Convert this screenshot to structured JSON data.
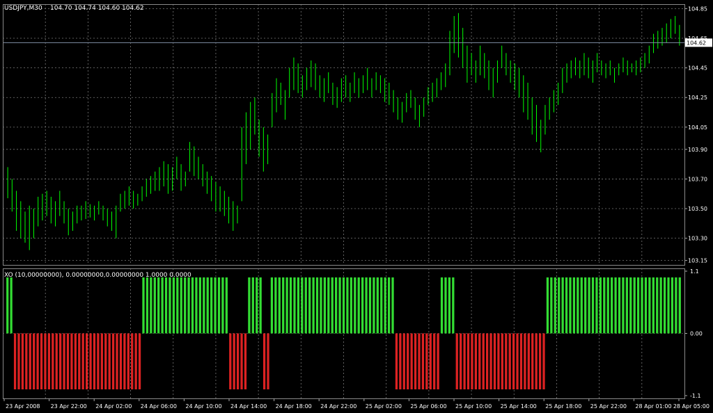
{
  "chart_data": [
    {
      "type": "bar",
      "title": "USDJPY,M30",
      "ohlc_text": "104.70 104.74 104.60 104.62",
      "bar_style": "HL-bars",
      "series_color": "#00ff00",
      "ylim": [
        103.12,
        104.88
      ],
      "y_ticks": [
        "104.85",
        "104.65",
        "104.45",
        "104.25",
        "104.05",
        "103.90",
        "103.70",
        "103.50",
        "103.30",
        "103.15"
      ],
      "current_price": "104.62",
      "current_price_line_color": "#7f8fa6",
      "grid": true,
      "grid_color": "#7a7a7a",
      "bars": [
        [
          103.78,
          103.57
        ],
        [
          103.7,
          103.48
        ],
        [
          103.62,
          103.35
        ],
        [
          103.55,
          103.3
        ],
        [
          103.48,
          103.27
        ],
        [
          103.52,
          103.22
        ],
        [
          103.5,
          103.3
        ],
        [
          103.58,
          103.38
        ],
        [
          103.6,
          103.42
        ],
        [
          103.62,
          103.45
        ],
        [
          103.58,
          103.4
        ],
        [
          103.55,
          103.38
        ],
        [
          103.62,
          103.45
        ],
        [
          103.55,
          103.4
        ],
        [
          103.5,
          103.32
        ],
        [
          103.48,
          103.35
        ],
        [
          103.52,
          103.4
        ],
        [
          103.52,
          103.42
        ],
        [
          103.55,
          103.43
        ],
        [
          103.53,
          103.44
        ],
        [
          103.52,
          103.42
        ],
        [
          103.55,
          103.46
        ],
        [
          103.52,
          103.42
        ],
        [
          103.5,
          103.38
        ],
        [
          103.48,
          103.35
        ],
        [
          103.52,
          103.3
        ],
        [
          103.6,
          103.48
        ],
        [
          103.62,
          103.5
        ],
        [
          103.65,
          103.52
        ],
        [
          103.62,
          103.5
        ],
        [
          103.6,
          103.52
        ],
        [
          103.65,
          103.55
        ],
        [
          103.7,
          103.58
        ],
        [
          103.72,
          103.6
        ],
        [
          103.75,
          103.62
        ],
        [
          103.78,
          103.62
        ],
        [
          103.82,
          103.65
        ],
        [
          103.8,
          103.6
        ],
        [
          103.78,
          103.62
        ],
        [
          103.85,
          103.7
        ],
        [
          103.8,
          103.62
        ],
        [
          103.75,
          103.65
        ],
        [
          103.95,
          103.75
        ],
        [
          103.92,
          103.72
        ],
        [
          103.85,
          103.7
        ],
        [
          103.8,
          103.65
        ],
        [
          103.75,
          103.6
        ],
        [
          103.72,
          103.55
        ],
        [
          103.68,
          103.48
        ],
        [
          103.65,
          103.48
        ],
        [
          103.62,
          103.45
        ],
        [
          103.58,
          103.4
        ],
        [
          103.55,
          103.35
        ],
        [
          103.52,
          103.4
        ],
        [
          104.05,
          103.55
        ],
        [
          104.15,
          103.8
        ],
        [
          104.22,
          103.9
        ],
        [
          104.25,
          104.0
        ],
        [
          104.1,
          103.85
        ],
        [
          104.05,
          103.75
        ],
        [
          104.0,
          103.8
        ],
        [
          104.28,
          104.05
        ],
        [
          104.38,
          104.15
        ],
        [
          104.35,
          104.2
        ],
        [
          104.3,
          104.1
        ],
        [
          104.45,
          104.25
        ],
        [
          104.52,
          104.3
        ],
        [
          104.48,
          104.28
        ],
        [
          104.4,
          104.25
        ],
        [
          104.45,
          104.3
        ],
        [
          104.5,
          104.32
        ],
        [
          104.48,
          104.3
        ],
        [
          104.4,
          104.25
        ],
        [
          104.38,
          104.22
        ],
        [
          104.42,
          104.28
        ],
        [
          104.35,
          104.2
        ],
        [
          104.32,
          104.18
        ],
        [
          104.38,
          104.22
        ],
        [
          104.4,
          104.25
        ],
        [
          104.35,
          104.22
        ],
        [
          104.42,
          104.28
        ],
        [
          104.38,
          104.25
        ],
        [
          104.4,
          104.28
        ],
        [
          104.45,
          104.3
        ],
        [
          104.38,
          104.25
        ],
        [
          104.42,
          104.3
        ],
        [
          104.4,
          104.28
        ],
        [
          104.38,
          104.22
        ],
        [
          104.35,
          104.2
        ],
        [
          104.3,
          104.15
        ],
        [
          104.25,
          104.1
        ],
        [
          104.22,
          104.08
        ],
        [
          104.28,
          104.15
        ],
        [
          104.3,
          104.18
        ],
        [
          104.25,
          104.1
        ],
        [
          104.2,
          104.05
        ],
        [
          104.25,
          104.12
        ],
        [
          104.32,
          104.2
        ],
        [
          104.35,
          104.22
        ],
        [
          104.38,
          104.25
        ],
        [
          104.42,
          104.3
        ],
        [
          104.48,
          104.32
        ],
        [
          104.7,
          104.4
        ],
        [
          104.8,
          104.55
        ],
        [
          104.82,
          104.52
        ],
        [
          104.72,
          104.45
        ],
        [
          104.6,
          104.35
        ],
        [
          104.55,
          104.4
        ],
        [
          104.5,
          104.35
        ],
        [
          104.6,
          104.4
        ],
        [
          104.55,
          104.38
        ],
        [
          104.5,
          104.3
        ],
        [
          104.45,
          104.25
        ],
        [
          104.5,
          104.35
        ],
        [
          104.6,
          104.45
        ],
        [
          104.55,
          104.4
        ],
        [
          104.5,
          104.35
        ],
        [
          104.48,
          104.3
        ],
        [
          104.45,
          104.25
        ],
        [
          104.4,
          104.15
        ],
        [
          104.35,
          104.1
        ],
        [
          104.25,
          104.0
        ],
        [
          104.2,
          103.95
        ],
        [
          104.1,
          103.88
        ],
        [
          104.2,
          104.0
        ],
        [
          104.25,
          104.1
        ],
        [
          104.3,
          104.15
        ],
        [
          104.35,
          104.2
        ],
        [
          104.45,
          104.28
        ],
        [
          104.48,
          104.35
        ],
        [
          104.5,
          104.38
        ],
        [
          104.52,
          104.4
        ],
        [
          104.5,
          104.38
        ],
        [
          104.55,
          104.4
        ],
        [
          104.52,
          104.38
        ],
        [
          104.5,
          104.35
        ],
        [
          104.55,
          104.42
        ],
        [
          104.5,
          104.4
        ],
        [
          104.48,
          104.38
        ],
        [
          104.5,
          104.4
        ],
        [
          104.45,
          104.35
        ],
        [
          104.48,
          104.4
        ],
        [
          104.52,
          104.42
        ],
        [
          104.5,
          104.4
        ],
        [
          104.48,
          104.42
        ],
        [
          104.5,
          104.4
        ],
        [
          104.52,
          104.42
        ],
        [
          104.55,
          104.45
        ],
        [
          104.6,
          104.48
        ],
        [
          104.68,
          104.55
        ],
        [
          104.7,
          104.58
        ],
        [
          104.72,
          104.6
        ],
        [
          104.75,
          104.62
        ],
        [
          104.78,
          104.65
        ],
        [
          104.8,
          104.68
        ],
        [
          104.74,
          104.6
        ]
      ]
    },
    {
      "type": "bar",
      "title": "XO (10,00000000), 0.00000000,0.00000000 1.0000 0.0000",
      "ylim": [
        -1.1,
        1.1
      ],
      "y_ticks": [
        "1.1",
        "0.00",
        "-1.1"
      ],
      "positive_color": "#33dd33",
      "negative_color": "#dd2222",
      "values": [
        1,
        1,
        -1,
        -1,
        -1,
        -1,
        -1,
        -1,
        -1,
        -1,
        -1,
        -1,
        -1,
        -1,
        -1,
        -1,
        -1,
        -1,
        -1,
        -1,
        -1,
        -1,
        -1,
        -1,
        -1,
        -1,
        -1,
        -1,
        -1,
        -1,
        -1,
        -1,
        -1,
        -1,
        -1,
        -1,
        1,
        1,
        1,
        1,
        1,
        1,
        1,
        1,
        1,
        1,
        1,
        1,
        1,
        1,
        1,
        1,
        1,
        1,
        1,
        1,
        1,
        1,
        1,
        -1,
        -1,
        -1,
        -1,
        -1,
        1,
        1,
        1,
        1,
        -1,
        -1,
        1,
        1,
        1,
        1,
        1,
        1,
        1,
        1,
        1,
        1,
        1,
        1,
        1,
        1,
        1,
        1,
        1,
        1,
        1,
        1,
        1,
        1,
        1,
        1,
        1,
        1,
        1,
        1,
        1,
        1,
        1,
        1,
        1,
        -1,
        -1,
        -1,
        -1,
        -1,
        -1,
        -1,
        -1,
        -1,
        -1,
        -1,
        -1,
        1,
        1,
        1,
        1,
        -1,
        -1,
        -1,
        -1,
        -1,
        -1,
        -1,
        -1,
        -1,
        -1,
        -1,
        -1,
        -1,
        -1,
        -1,
        -1,
        -1,
        -1,
        -1,
        -1,
        -1,
        -1,
        -1,
        -1,
        1,
        1,
        1,
        1,
        1,
        1,
        1,
        1,
        1,
        1,
        1,
        1,
        1,
        1,
        1,
        1,
        1,
        1,
        1,
        1,
        1,
        1,
        1,
        1,
        1,
        1,
        1,
        1,
        1,
        1,
        1,
        1,
        1,
        1,
        1,
        1
      ]
    }
  ],
  "x_ticks": [
    "23 Apr 2008",
    "23 Apr 22:00",
    "24 Apr 02:00",
    "24 Apr 06:00",
    "24 Apr 10:00",
    "24 Apr 14:00",
    "24 Apr 18:00",
    "24 Apr 22:00",
    "25 Apr 02:00",
    "25 Apr 06:00",
    "25 Apr 10:00",
    "25 Apr 14:00",
    "25 Apr 18:00",
    "25 Apr 22:00",
    "28 Apr 01:00",
    "28 Apr 05:00"
  ]
}
